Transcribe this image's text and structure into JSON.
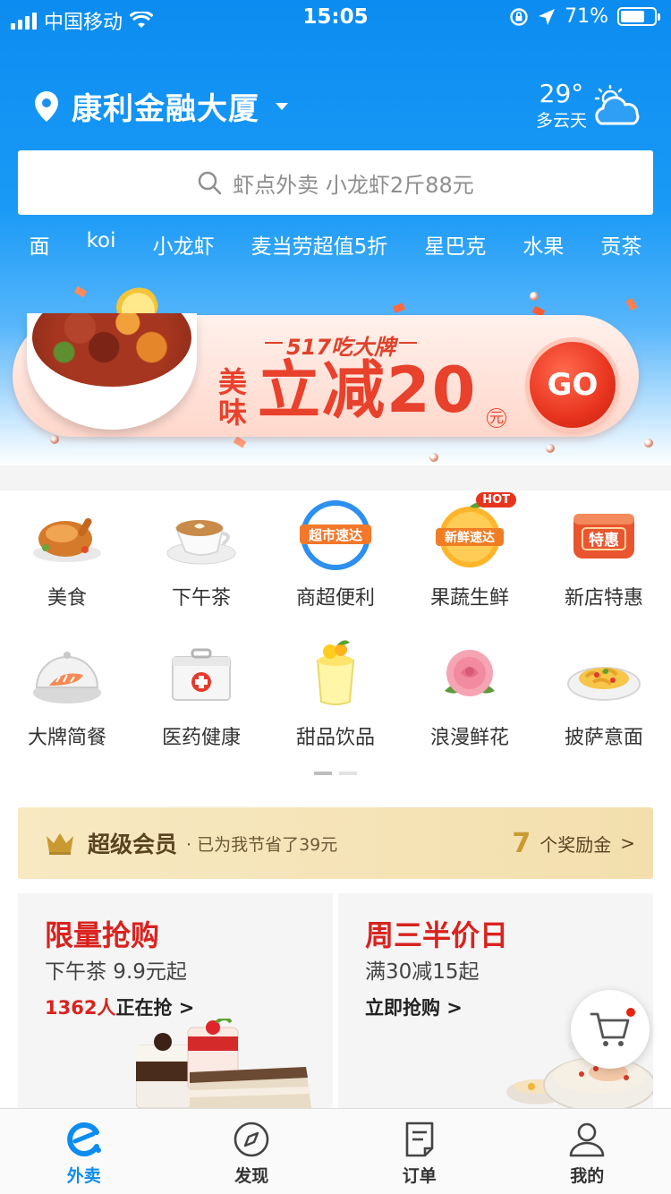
{
  "status_bar": {
    "carrier": "中国移动",
    "time": "15:05",
    "battery": "71%",
    "battery_level": 0.71
  },
  "header": {
    "location": "康利金融大厦",
    "weather": {
      "temp": "29°",
      "desc": "多云天",
      "icon": "cloud-sun-icon"
    },
    "search": {
      "placeholder": "虾点外卖 小龙虾2斤88元"
    },
    "hot_words": [
      "面",
      "koi",
      "小龙虾",
      "麦当劳超值5折",
      "星巴克",
      "水果",
      "贡茶"
    ]
  },
  "banner": {
    "tag": "517吃大牌",
    "prefix": "美味",
    "headline": "立减20",
    "unit": "元",
    "button": "GO"
  },
  "categories": [
    {
      "label": "美食",
      "icon": "roast-chicken-icon"
    },
    {
      "label": "下午茶",
      "icon": "coffee-cup-icon"
    },
    {
      "label": "商超便利",
      "icon": "supermarket-icon",
      "icon_text": "超市速达"
    },
    {
      "label": "果蔬生鲜",
      "icon": "fresh-produce-icon",
      "icon_text": "新鲜速达",
      "badge": "HOT"
    },
    {
      "label": "新店特惠",
      "icon": "new-store-icon",
      "icon_text": "特惠"
    },
    {
      "label": "大牌简餐",
      "icon": "salmon-plate-icon"
    },
    {
      "label": "医药健康",
      "icon": "medicine-box-icon"
    },
    {
      "label": "甜品饮品",
      "icon": "dessert-cup-icon"
    },
    {
      "label": "浪漫鲜花",
      "icon": "rose-icon"
    },
    {
      "label": "披萨意面",
      "icon": "pasta-icon"
    }
  ],
  "vip": {
    "title": "超级会员",
    "saved": "· 已为我节省了39元",
    "count": "7",
    "reward": "个奖励金",
    "arrow": ">",
    "icon": "crown-icon"
  },
  "promos": [
    {
      "title": "限量抢购",
      "subtitle": "下午茶 9.9元起",
      "highlight": "1362人",
      "link": "正在抢 >"
    },
    {
      "title": "周三半价日",
      "subtitle": "满30减15起",
      "highlight": "",
      "link": "立即抢购 >"
    }
  ],
  "tabbar": [
    {
      "label": "外卖",
      "icon": "eleme-logo-icon",
      "active": true
    },
    {
      "label": "发现",
      "icon": "compass-icon",
      "active": false
    },
    {
      "label": "订单",
      "icon": "order-list-icon",
      "active": false
    },
    {
      "label": "我的",
      "icon": "user-icon",
      "active": false
    }
  ],
  "colors": {
    "brand_blue": "#0c8cf0",
    "promo_red": "#d8231f",
    "vip_gold": "#c99a32"
  }
}
